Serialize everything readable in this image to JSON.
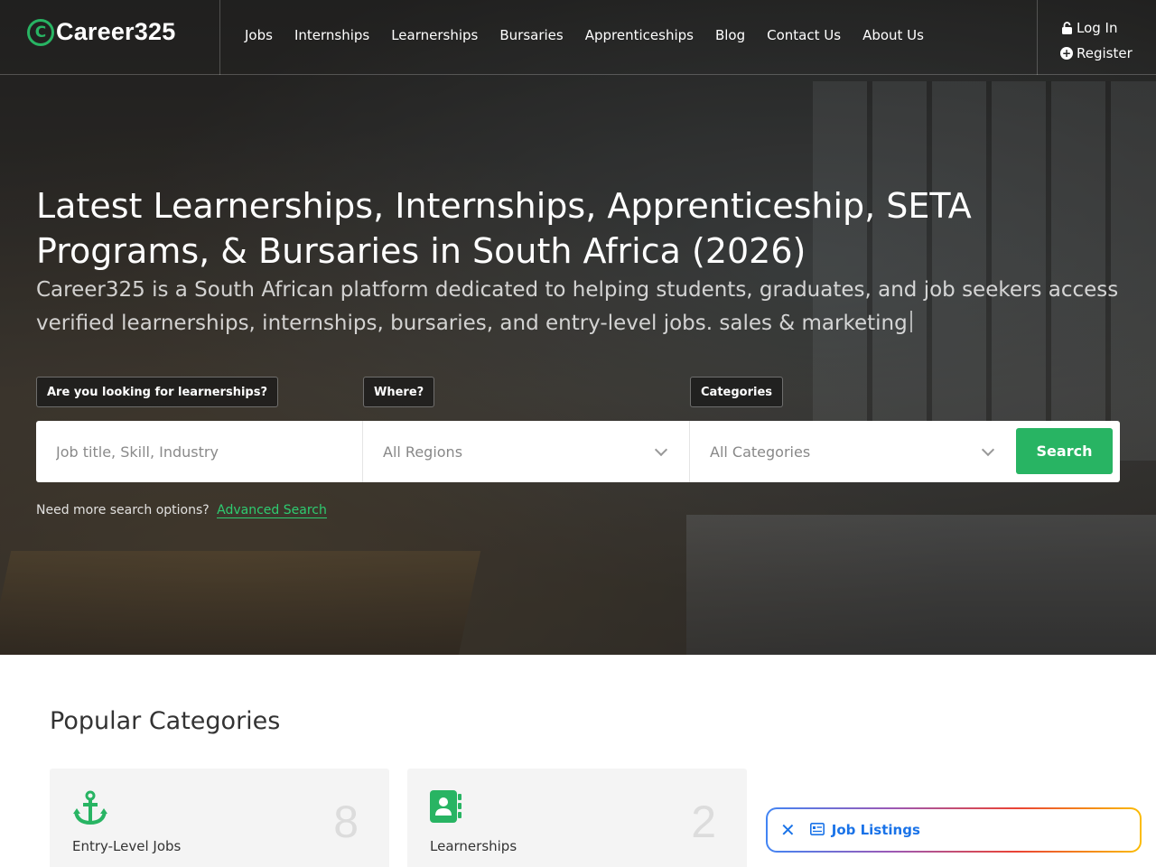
{
  "brand": {
    "logo_mark": "C",
    "name": "Career325",
    "accent": "#28b463"
  },
  "nav": {
    "items": [
      "Jobs",
      "Internships",
      "Learnerships",
      "Bursaries",
      "Apprenticeships",
      "Blog",
      "Contact Us",
      "About Us"
    ]
  },
  "auth": {
    "login": "Log In",
    "register": "Register"
  },
  "hero": {
    "title": "Latest Learnerships, Internships, Apprenticeship, SETA Programs, & Bursaries in South Africa (2026)",
    "subtitle": "Career325 is a South African platform dedicated to helping students, graduates, and job seekers access verified learnerships, internships, bursaries, and entry-level jobs. sales & marketing"
  },
  "search": {
    "tags": [
      "Are you looking for learnerships?",
      "Where?",
      "Categories"
    ],
    "keyword_placeholder": "Job title, Skill, Industry",
    "region_value": "All Regions",
    "category_value": "All Categories",
    "button": "Search",
    "more_text": "Need more search options?",
    "advanced_link": "Advanced Search"
  },
  "categories": {
    "title": "Popular Categories",
    "items": [
      {
        "name": "Entry-Level Jobs",
        "count": "8",
        "icon": "anchor-icon"
      },
      {
        "name": "Learnerships",
        "count": "2",
        "icon": "contact-book-icon"
      }
    ]
  },
  "widget": {
    "label": "Job Listings",
    "icon": "listing-icon",
    "close_icon": "close-icon"
  }
}
